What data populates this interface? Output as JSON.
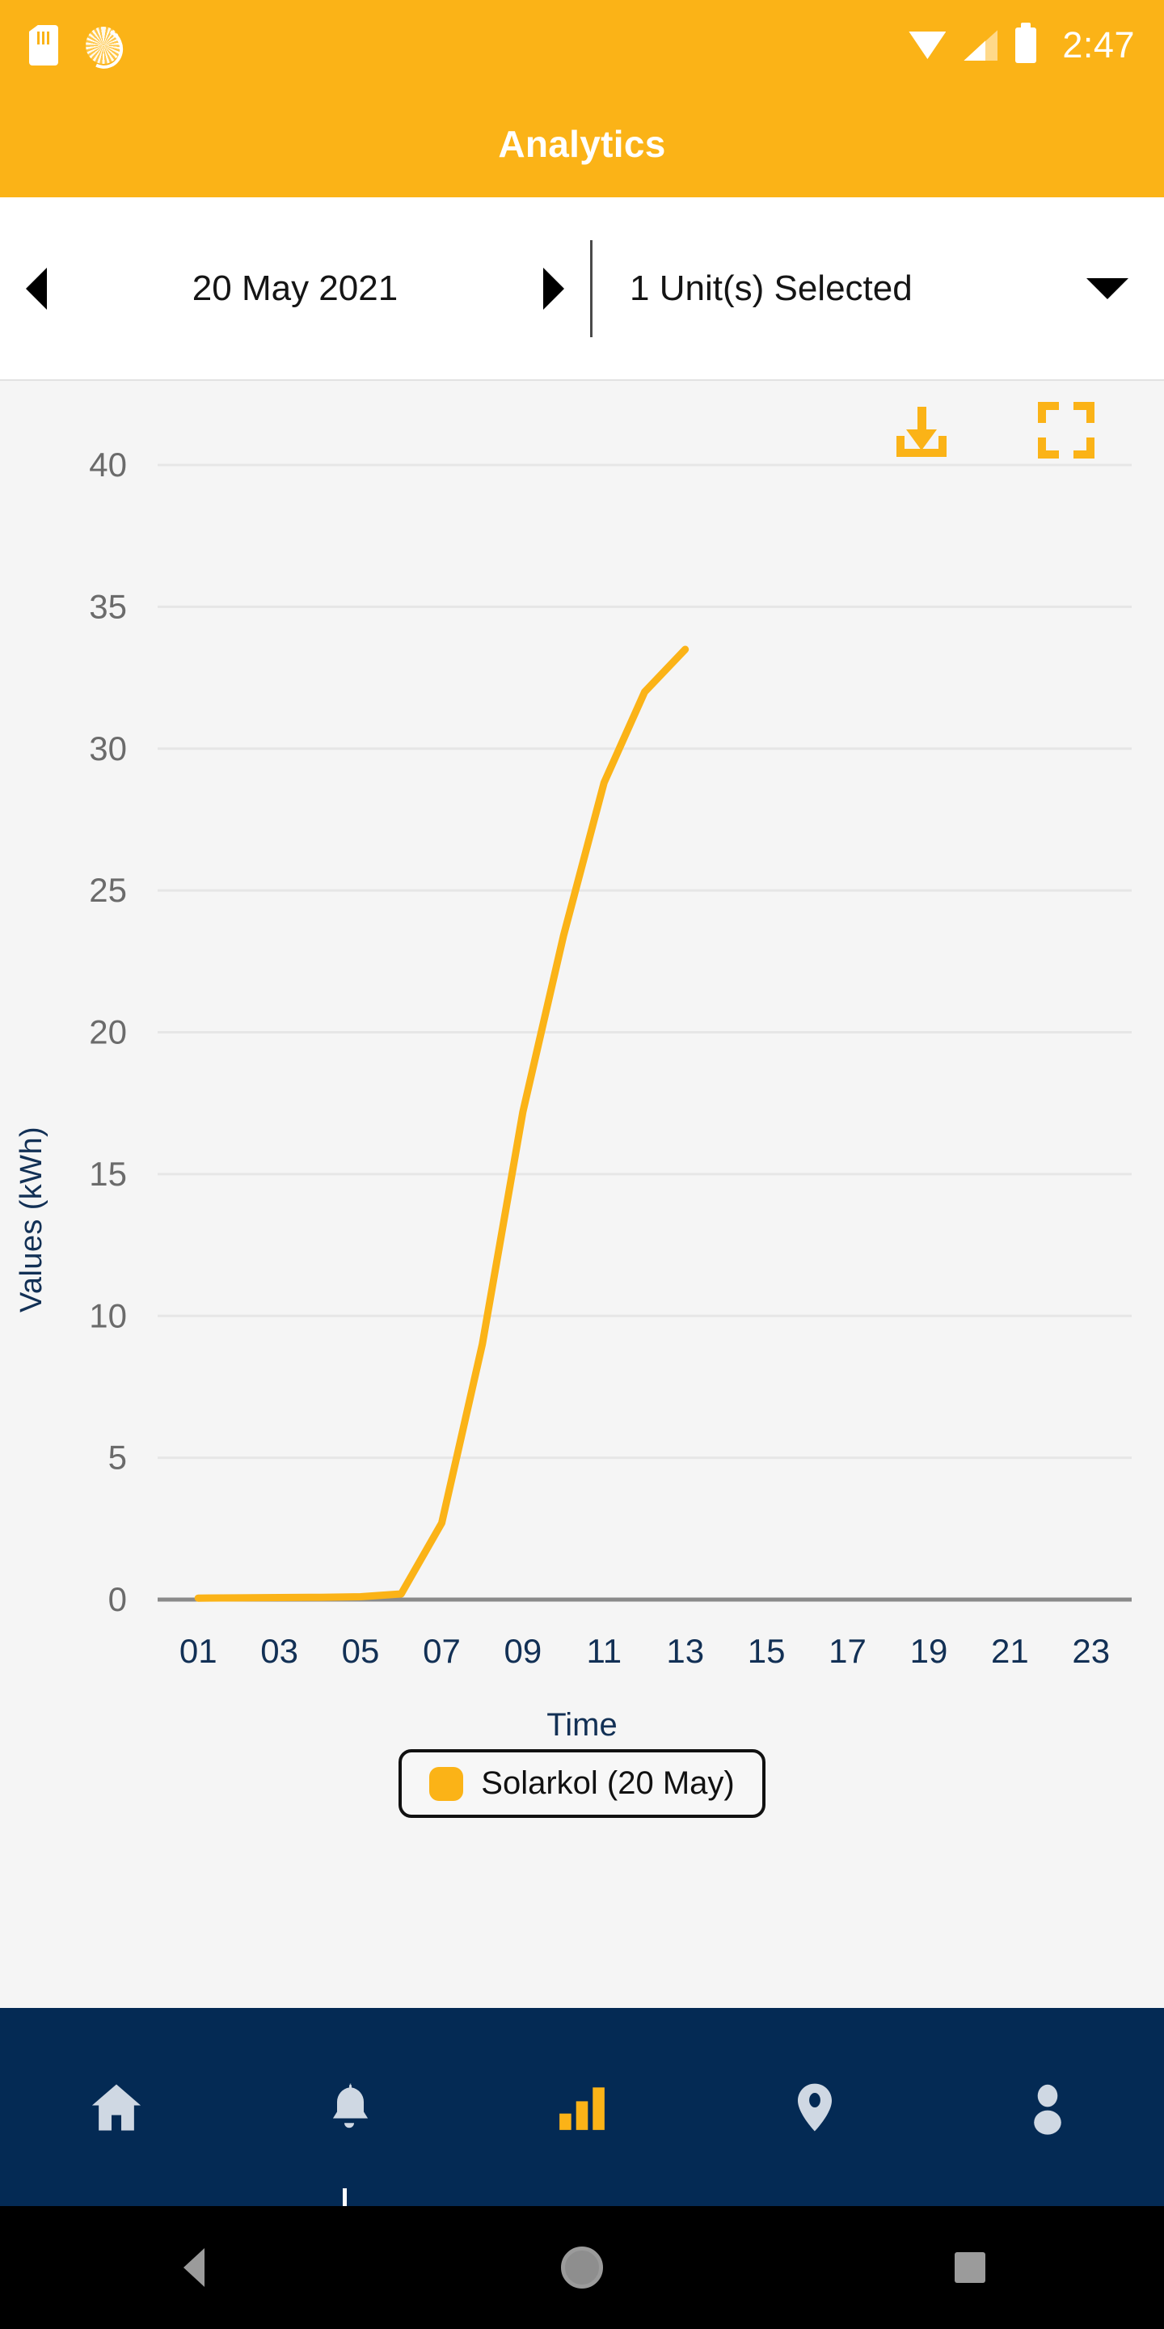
{
  "status_bar": {
    "time": "2:47",
    "icons": [
      "sd-card-icon",
      "sun-icon",
      "wifi-icon",
      "cellular-signal-icon",
      "battery-icon"
    ]
  },
  "app_bar": {
    "title": "Analytics"
  },
  "filter_bar": {
    "prev_label": "◀",
    "date": "20 May 2021",
    "next_label": "▶",
    "unit_selector": "1 Unit(s) Selected",
    "caret": "▼"
  },
  "chart_toolbar": {
    "download_label": "download-icon",
    "fullscreen_label": "fullscreen-icon"
  },
  "legend": {
    "series_label": "Solarkol (20 May)",
    "color": "#fbb317"
  },
  "bottom_nav": {
    "items": [
      {
        "name": "home",
        "active": false
      },
      {
        "name": "notifications",
        "active": false
      },
      {
        "name": "analytics",
        "active": true
      },
      {
        "name": "locations",
        "active": false
      },
      {
        "name": "profile",
        "active": false
      }
    ],
    "active_color": "#fbb317",
    "inactive_color": "#cfd8e3",
    "background": "#042a54"
  },
  "system_nav": {
    "buttons": [
      "back",
      "home",
      "recents"
    ]
  },
  "colors": {
    "accent": "#fbb317",
    "axis_text": "#123055",
    "tick_text": "#6b6b6b",
    "plot_bg": "#f5f5f5",
    "grid": "#e6e6e6"
  },
  "chart_data": {
    "type": "line",
    "title": "",
    "xlabel": "Time",
    "ylabel": "Values (kWh)",
    "xlim": [
      0,
      24
    ],
    "ylim": [
      0,
      42
    ],
    "yticks": [
      0,
      5,
      10,
      15,
      20,
      25,
      30,
      35,
      40
    ],
    "xticks": [
      "01",
      "03",
      "05",
      "07",
      "09",
      "11",
      "13",
      "15",
      "17",
      "19",
      "21",
      "23"
    ],
    "grid": true,
    "legend_position": "bottom",
    "series": [
      {
        "name": "Solarkol (20 May)",
        "color": "#fbb317",
        "x": [
          1,
          2,
          3,
          4,
          5,
          6,
          7,
          8,
          9,
          10,
          11,
          12,
          13
        ],
        "values": [
          0.05,
          0.06,
          0.07,
          0.08,
          0.1,
          0.2,
          2.7,
          9.0,
          17.2,
          23.4,
          28.8,
          32.0,
          33.5
        ]
      }
    ]
  }
}
